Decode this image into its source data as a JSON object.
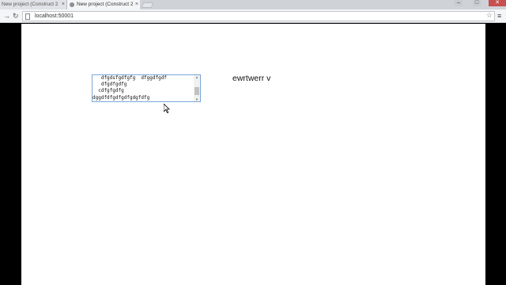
{
  "browser": {
    "tabs": [
      {
        "title": "New project (Construct 2",
        "active": false
      },
      {
        "title": "New project (Construct 2",
        "active": true
      }
    ],
    "tab_close_glyph": "×",
    "address": "localhost:50001",
    "window_buttons": {
      "minimize": "–",
      "maximize": "□",
      "close": "✕"
    },
    "icons": [
      "back-arrow-icon",
      "reload-icon",
      "page-icon",
      "star-icon",
      "menu-icon"
    ]
  },
  "page": {
    "textarea_value": "   dfgdsfgdfgfg  dfggdfgdf\n   dfgdfgdfg\n  cdfgfgdfg\ndggdfdfgdfgdfgdgfdfg",
    "label_text": "ewrtwerr v",
    "canvas_color": "#ffffff",
    "focus_border_color": "#7aa7d8"
  }
}
